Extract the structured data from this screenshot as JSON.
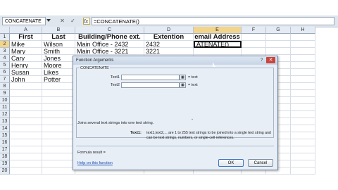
{
  "formula_bar": {
    "name_box": "CONCATENATE",
    "cancel_glyph": "✕",
    "enter_glyph": "✓",
    "fx_label": "fx",
    "formula": "=CONCATENATE()"
  },
  "columns": [
    "A",
    "B",
    "C",
    "D",
    "E",
    "F",
    "G",
    "H"
  ],
  "rows": [
    "1",
    "2",
    "3",
    "4",
    "5",
    "6",
    "7",
    "8",
    "9",
    "10",
    "11",
    "12",
    "13",
    "14",
    "15",
    "16",
    "17",
    "18",
    "19",
    "20"
  ],
  "cells": {
    "headers": [
      "First",
      "Last",
      "Building/Phone ext.",
      "Extention",
      "email Address"
    ],
    "data": [
      [
        "Mike",
        "Wilson",
        "Main Office - 2432",
        "2432",
        "ATENATE()"
      ],
      [
        "Mary",
        "Smith",
        "Main Office - 3221",
        "3221",
        ""
      ],
      [
        "Cary",
        "Jones",
        "",
        "",
        ""
      ],
      [
        "Henry",
        "Moore",
        "",
        "",
        ""
      ],
      [
        "Susan",
        "Likes",
        "",
        "",
        ""
      ],
      [
        "John",
        "Potter",
        "",
        "",
        ""
      ]
    ]
  },
  "dialog": {
    "title": "Function Arguments",
    "help_glyph": "?",
    "close_glyph": "✕",
    "group_label": "CONCATENATE",
    "args": [
      {
        "label": "Text1",
        "value": "",
        "eq": "= text"
      },
      {
        "label": "Text2",
        "value": "",
        "eq": "= text"
      }
    ],
    "scroll_glyph": "⌄",
    "description": "Joins several text strings into one text string.",
    "arg_desc_label": "Text1:",
    "arg_desc": "text1,text2,... are 1 to 255 text strings to be joined into a single text string and can be text strings, numbers, or single-cell references.",
    "result_label": "Formula result =",
    "help_link": "Help on this function",
    "ok": "OK",
    "cancel": "Cancel"
  }
}
